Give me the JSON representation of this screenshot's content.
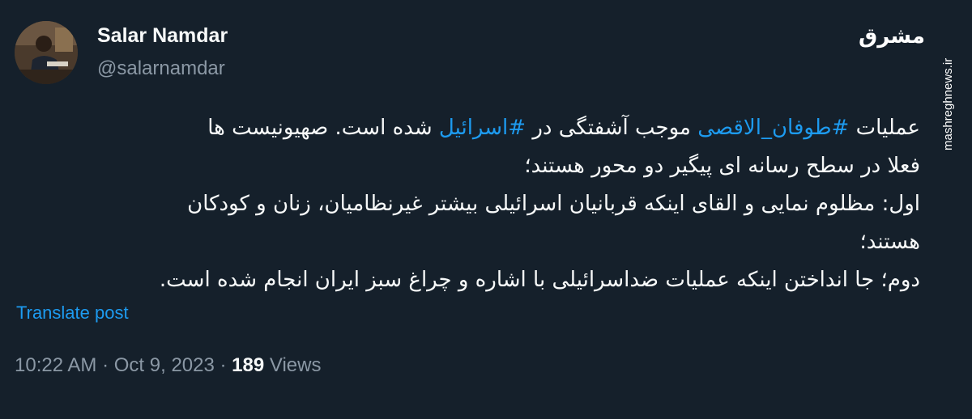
{
  "author": {
    "display_name": "Salar Namdar",
    "handle": "@salarnamdar",
    "avatar_icon": "user-avatar-photo"
  },
  "watermark": {
    "logo_text": "مشرق",
    "url": "mashreghnews.ir"
  },
  "tweet": {
    "line1": {
      "t1": "عملیات ",
      "hashtag1": "#طوفان_الاقصی",
      "t2": " موجب آشفتگی در ",
      "hashtag2": "#اسرائیل",
      "t3": " شده است. صهیونیست ها"
    },
    "line2": "فعلا در سطح رسانه ای پیگیر دو محور هستند؛",
    "line3": "اول: مظلوم نمایی و القای اینکه قربانیان اسرائیلی بیشتر غیرنظامیان، زنان و کودکان",
    "line4": "هستند؛",
    "line5": "دوم؛ جا انداختن اینکه عملیات ضداسرائیلی با اشاره و چراغ سبز ایران انجام شده است."
  },
  "translate_label": "Translate post",
  "meta": {
    "time": "10:22 AM",
    "separator": "·",
    "date": "Oct 9, 2023",
    "views_count": "189",
    "views_label": "Views"
  },
  "colors": {
    "background": "#15202b",
    "text": "#f7f9f9",
    "secondary": "#8b98a5",
    "accent": "#1d9bf0"
  }
}
